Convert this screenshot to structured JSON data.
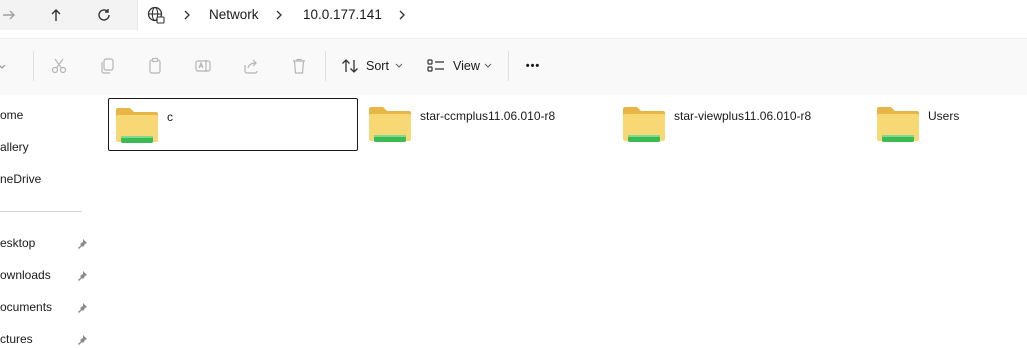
{
  "address_bar": {
    "crumbs": [
      "Network",
      "10.0.177.141"
    ]
  },
  "toolbar": {
    "sort_label": "Sort",
    "view_label": "View",
    "more_label": "•••"
  },
  "sidebar": {
    "items": [
      {
        "label": "ome",
        "pinned": false
      },
      {
        "label": "allery",
        "pinned": false
      },
      {
        "label": "neDrive",
        "pinned": false
      },
      {
        "label": "esktop",
        "pinned": true
      },
      {
        "label": "ownloads",
        "pinned": true
      },
      {
        "label": "ocuments",
        "pinned": true
      },
      {
        "label": "ctures",
        "pinned": true
      }
    ]
  },
  "folders": [
    {
      "name": "c",
      "selected": true
    },
    {
      "name": "star-ccmplus11.06.010-r8",
      "selected": false
    },
    {
      "name": "star-viewplus11.06.010-r8",
      "selected": false
    },
    {
      "name": "Users",
      "selected": false
    }
  ],
  "colors": {
    "folder_yellow": "#f8d775",
    "share_green": "#3cba54",
    "selection_border": "#1a1a1a"
  }
}
